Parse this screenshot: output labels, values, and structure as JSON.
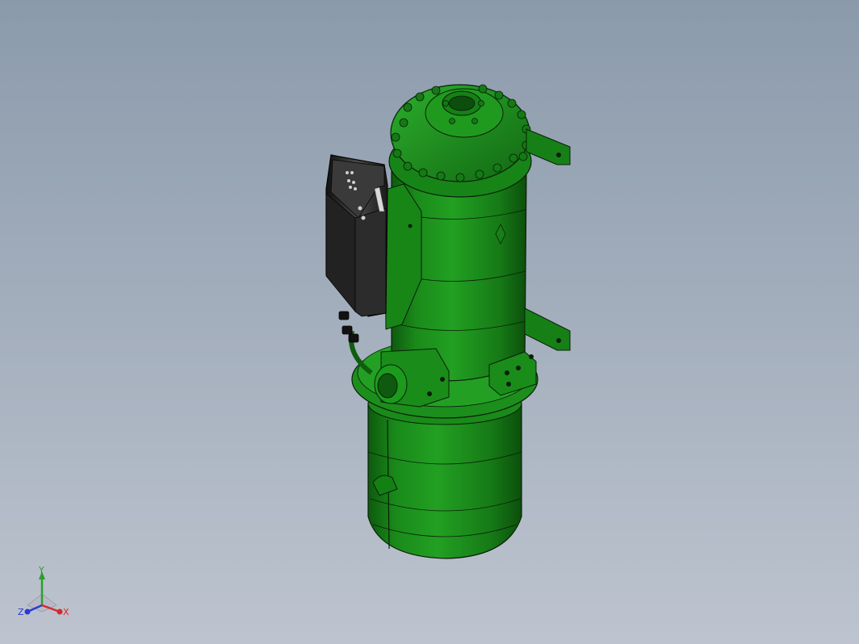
{
  "viewport": {
    "background_top": "#8b9aab",
    "background_bottom": "#bdc4cf"
  },
  "model": {
    "body_color": "#1d8a1d",
    "body_dark": "#0f5e0f",
    "body_light": "#35b035",
    "edge_color": "#0a1f0a",
    "terminal_box_color": "#1a1a1a",
    "terminal_box_face": "#3a3a3a"
  },
  "triad": {
    "x_label": "X",
    "y_label": "Y",
    "z_label": "Z",
    "x_color": "#d42a2a",
    "y_color": "#2aa02a",
    "z_color": "#2a3ad4"
  }
}
